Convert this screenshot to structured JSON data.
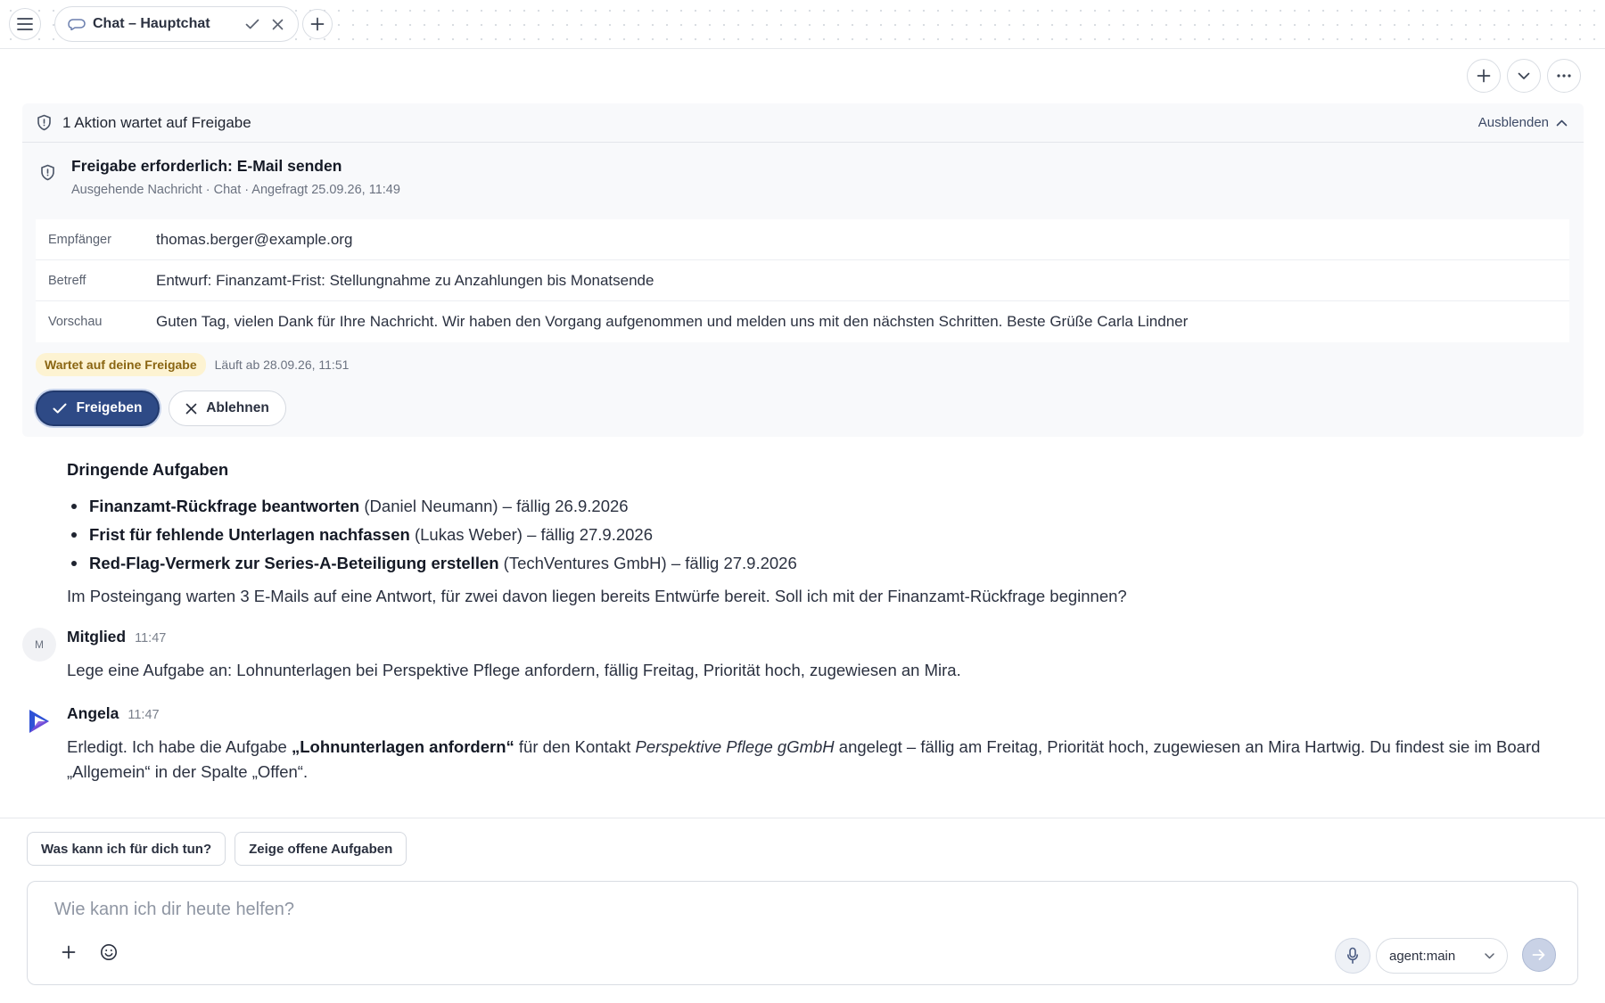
{
  "tabbar": {
    "tab_title": "Chat – Hauptchat"
  },
  "approval": {
    "header": "1 Aktion wartet auf Freigabe",
    "hide_label": "Ausblenden",
    "title": "Freigabe erforderlich: E-Mail senden",
    "subtitle": "Ausgehende Nachricht · Chat · Angefragt 25.09.26, 11:49",
    "rows": [
      {
        "label": "Empfänger",
        "value": "thomas.berger@example.org"
      },
      {
        "label": "Betreff",
        "value": "Entwurf: Finanzamt-Frist: Stellungnahme zu Anzahlungen bis Monatsende"
      },
      {
        "label": "Vorschau",
        "value": "Guten Tag, vielen Dank für Ihre Nachricht. Wir haben den Vorgang aufgenommen und melden uns mit den nächsten Schritten. Beste Grüße Carla Lindner"
      }
    ],
    "status_badge": "Wartet auf deine Freigabe",
    "status_time": "Läuft ab 28.09.26, 11:51",
    "approve_label": "Freigeben",
    "reject_label": "Ablehnen"
  },
  "summary": {
    "heading": "Dringende Aufgaben",
    "items": [
      {
        "bold": "Finanzamt-Rückfrage beantworten",
        "rest": " (Daniel Neumann) – fällig 26.9.2026"
      },
      {
        "bold": "Frist für fehlende Unterlagen nachfassen",
        "rest": " (Lukas Weber) – fällig 27.9.2026"
      },
      {
        "bold": "Red-Flag-Vermerk zur Series-A-Beteiligung erstellen",
        "rest": " (TechVentures GmbH) – fällig 27.9.2026"
      }
    ],
    "outro": "Im Posteingang warten 3 E-Mails auf eine Antwort, für zwei davon liegen bereits Entwürfe bereit. Soll ich mit der Finanzamt-Rückfrage beginnen?"
  },
  "messages": [
    {
      "avatar": "M",
      "name": "Mitglied",
      "time": "11:47",
      "text": "Lege eine Aufgabe an: Lohnunterlagen bei Perspektive Pflege anfordern, fällig Freitag, Priorität hoch, zugewiesen an Mira."
    },
    {
      "name": "Angela",
      "time": "11:47",
      "text_1": "Erledigt. Ich habe die Aufgabe ",
      "text_bold": "„Lohnunterlagen anfordern“",
      "text_2": " für den Kontakt ",
      "text_italic": "Perspektive Pflege gGmbH",
      "text_3": " angelegt – fällig am Freitag, Priorität hoch, zugewiesen an Mira Hartwig. Du findest sie im Board „Allgemein“ in der Spalte „Offen“."
    }
  ],
  "composer": {
    "chips": [
      "Was kann ich für dich tun?",
      "Zeige offene Aufgaben"
    ],
    "placeholder": "Wie kann ich dir heute helfen?",
    "model": "agent:main"
  },
  "colors": {
    "accent": "#2e4a86",
    "badge_bg": "#fdf3d2",
    "badge_text": "#8a6512",
    "logo_blue": "#2f52d6",
    "logo_violet": "#7b4bd8"
  }
}
